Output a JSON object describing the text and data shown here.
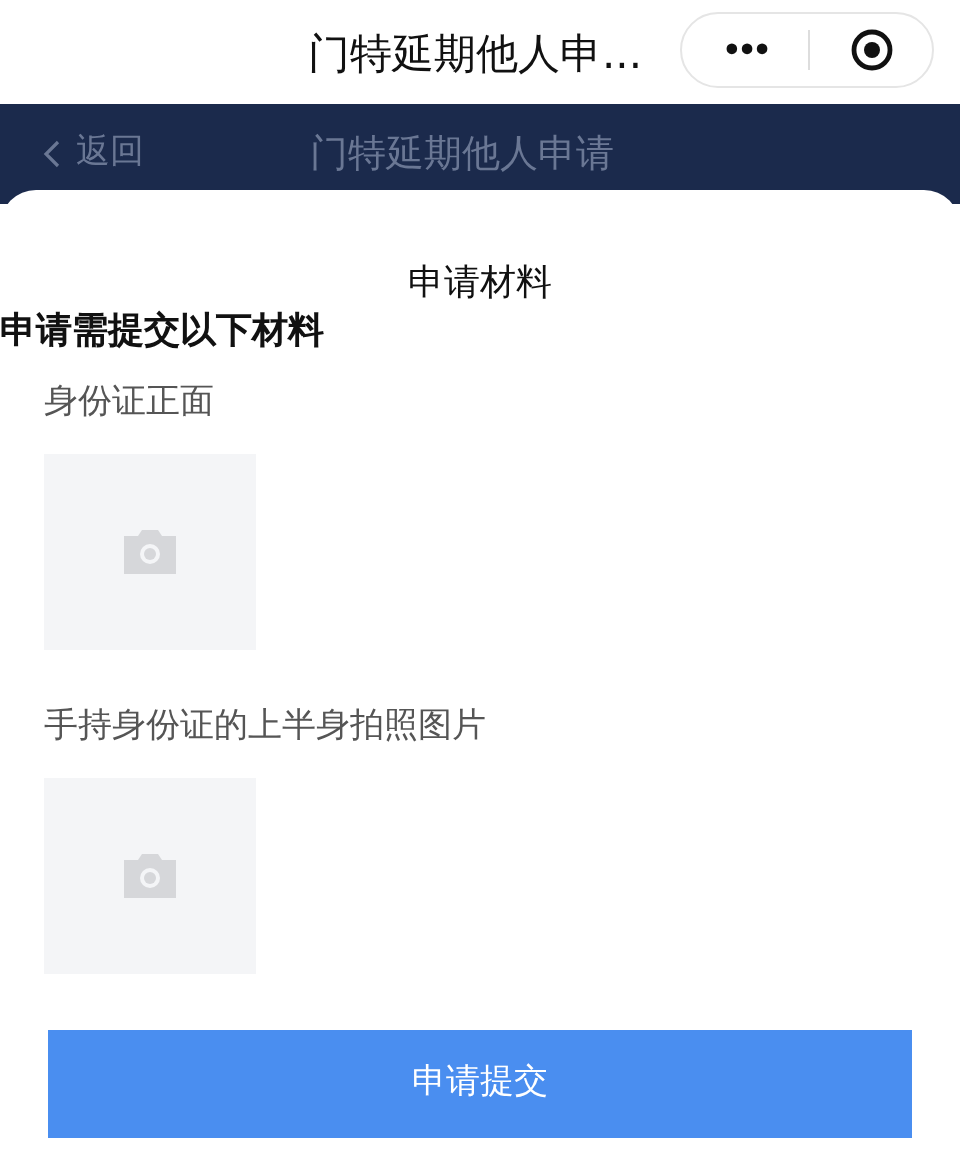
{
  "top_bar": {
    "title": "门特延期他人申...",
    "more_button": "•••"
  },
  "page_header": {
    "back": "返回",
    "title": "门特延期他人申请"
  },
  "sheet": {
    "title": "申请材料",
    "heading": "申请需提交以下材料",
    "materials": [
      {
        "label": "身份证正面"
      },
      {
        "label": "手持身份证的上半身拍照图片"
      }
    ],
    "submit_button": "申请提交"
  }
}
